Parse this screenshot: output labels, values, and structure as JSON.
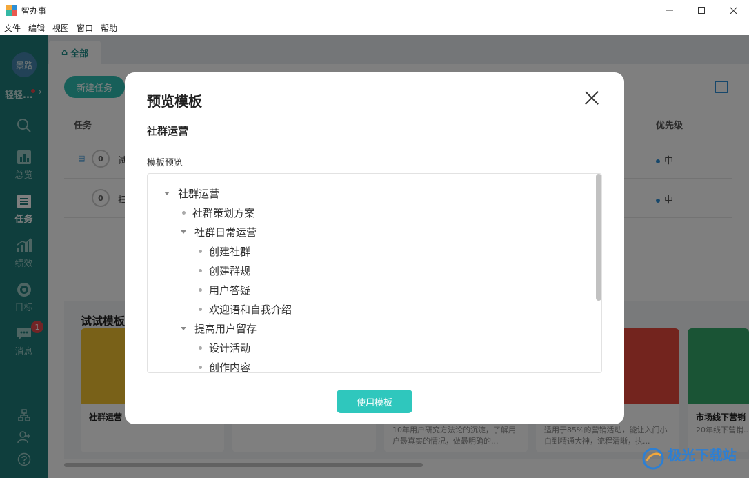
{
  "window": {
    "title": "智办事",
    "controls": [
      "minimize-icon",
      "maximize-icon",
      "close-icon"
    ]
  },
  "menu": [
    "文件",
    "编辑",
    "视图",
    "窗口",
    "帮助"
  ],
  "sidebar": {
    "avatar_text": "景路",
    "user_name": "轻轻...",
    "items": [
      {
        "label": "",
        "icon": "search-icon"
      },
      {
        "label": "总览",
        "icon": "overview-icon"
      },
      {
        "label": "任务",
        "icon": "task-icon",
        "active": true
      },
      {
        "label": "绩效",
        "icon": "performance-icon"
      },
      {
        "label": "目标",
        "icon": "target-icon"
      },
      {
        "label": "消息",
        "icon": "message-icon",
        "badge": "1"
      }
    ]
  },
  "main": {
    "tab_label": "全部",
    "new_task_label": "新建任务",
    "columns": {
      "task": "任务",
      "priority": "优先级"
    },
    "rows": [
      {
        "count": "0",
        "title": "试",
        "priority": "中"
      },
      {
        "count": "0",
        "title": "扫",
        "priority": "中"
      }
    ],
    "template_section_title": "试试模板",
    "template_cards": [
      {
        "name": "社群运营",
        "desc": ""
      },
      {
        "name": "",
        "desc": ""
      },
      {
        "name": "",
        "desc": "10年用户研究方法论的沉淀，了解用户最真实的情况，做最明确的..."
      },
      {
        "name": "",
        "desc": "适用于85%的营销活动，能让入门小白到精通大神，流程清晰，执..."
      },
      {
        "name": "市场线下营销",
        "desc": "20年线下营销..."
      }
    ]
  },
  "modal": {
    "title": "预览模板",
    "template_name": "社群运营",
    "preview_label": "模板预览",
    "tree": [
      {
        "text": "社群运营",
        "level": 0,
        "type": "caret"
      },
      {
        "text": "社群策划方案",
        "level": 1,
        "type": "bullet"
      },
      {
        "text": "社群日常运营",
        "level": 1,
        "type": "caret"
      },
      {
        "text": "创建社群",
        "level": 2,
        "type": "bullet"
      },
      {
        "text": "创建群规",
        "level": 2,
        "type": "bullet"
      },
      {
        "text": "用户答疑",
        "level": 2,
        "type": "bullet"
      },
      {
        "text": "欢迎语和自我介绍",
        "level": 2,
        "type": "bullet"
      },
      {
        "text": "提高用户留存",
        "level": 1,
        "type": "caret"
      },
      {
        "text": "设计活动",
        "level": 2,
        "type": "bullet"
      },
      {
        "text": "创作内容",
        "level": 2,
        "type": "bullet"
      }
    ],
    "use_button_label": "使用模板"
  },
  "watermark": {
    "text": "极光下载站"
  },
  "colors": {
    "accent": "#2fc7bd",
    "rail": "#1f7d7b",
    "badge": "#e5484d"
  }
}
